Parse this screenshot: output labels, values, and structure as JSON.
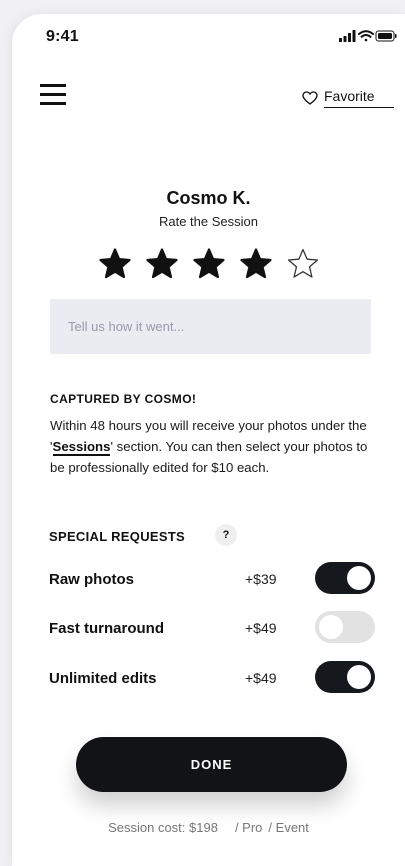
{
  "status_bar": {
    "time": "9:41"
  },
  "header": {
    "menu_icon": "hamburger-menu-icon",
    "favorite_icon": "heart-outline-icon",
    "favorite_label": "Favorite"
  },
  "profile": {
    "name": "Cosmo K.",
    "subtitle": "Rate the Session"
  },
  "rating": {
    "value": 4,
    "max": 5
  },
  "feedback": {
    "placeholder": "Tell us how it went...",
    "value": ""
  },
  "captured": {
    "heading": "CAPTURED BY COSMO!",
    "body_before": "Within 48 hours you will receive your photos under the '",
    "link_label": "Sessions",
    "body_after": "' section. You can then select your photos to be professionally edited for $10 each."
  },
  "special_requests": {
    "heading": "SPECIAL REQUESTS",
    "help_label": "?",
    "items": [
      {
        "name": "Raw photos",
        "price": "+$39",
        "enabled": true
      },
      {
        "name": "Fast turnaround",
        "price": "+$49",
        "enabled": false
      },
      {
        "name": "Unlimited edits",
        "price": "+$49",
        "enabled": true
      }
    ]
  },
  "done_label": "DONE",
  "footer": {
    "cost": "Session cost: $198",
    "plan": "/ Pro",
    "type": "/ Event"
  },
  "colors": {
    "accent": "#121316",
    "input_bg": "#ebebf2",
    "toggle_off": "#e2e2e2"
  }
}
